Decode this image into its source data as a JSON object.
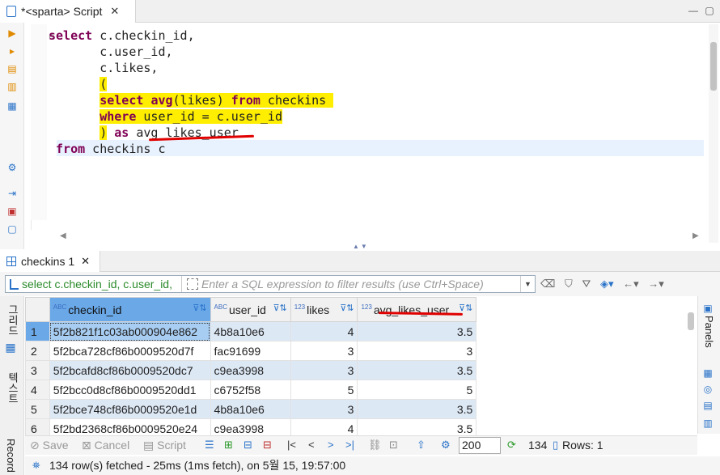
{
  "editor_tab": {
    "title": "*<sparta> Script",
    "close": "✕"
  },
  "window_controls": {
    "minimize": "—",
    "maximize": "▢"
  },
  "code_lines": [
    {
      "parts": [
        {
          "t": "select",
          "k": true
        },
        {
          "t": " c.checkin_id,"
        }
      ]
    },
    {
      "parts": [
        {
          "t": "       c.user_id,"
        }
      ]
    },
    {
      "parts": [
        {
          "t": "       c.likes,"
        }
      ]
    },
    {
      "parts": [
        {
          "t": "       "
        },
        {
          "t": "(",
          "h": true
        }
      ]
    },
    {
      "parts": [
        {
          "t": "       "
        },
        {
          "t": "select",
          "k": true,
          "h": true
        },
        {
          "t": " ",
          "h": true
        },
        {
          "t": "avg",
          "k": true,
          "h": true
        },
        {
          "t": "(likes) ",
          "h": true
        },
        {
          "t": "from",
          "k": true,
          "h": true
        },
        {
          "t": " checkins ",
          "h": true
        }
      ]
    },
    {
      "parts": [
        {
          "t": "       "
        },
        {
          "t": "where",
          "k": true,
          "h": true
        },
        {
          "t": " user_id = c.user_id",
          "h": true
        }
      ]
    },
    {
      "parts": [
        {
          "t": "       "
        },
        {
          "t": ")",
          "h": true
        },
        {
          "t": " "
        },
        {
          "t": "as",
          "k": true
        },
        {
          "t": " avg_likes_user"
        }
      ]
    },
    {
      "parts": [
        {
          "t": " "
        },
        {
          "t": "from",
          "k": true
        },
        {
          "t": " checkins c"
        }
      ]
    }
  ],
  "results_tab": {
    "title": "checkins 1",
    "close": "✕"
  },
  "filter": {
    "query": "select c.checkin_id, c.user_id,",
    "placeholder": "Enter a SQL expression to filter results (use Ctrl+Space)"
  },
  "side_tabs": {
    "grid": "그리드",
    "text": "텍스트",
    "record": "Record"
  },
  "panels_label": "Panels",
  "grid": {
    "columns": [
      {
        "name": "checkin_id",
        "type": "ABC"
      },
      {
        "name": "user_id",
        "type": "ABC"
      },
      {
        "name": "likes",
        "type": "123"
      },
      {
        "name": "avg_likes_user",
        "type": "123"
      }
    ],
    "rows": [
      {
        "n": "1",
        "checkin_id": "5f2b821f1c03ab000904e862",
        "user_id": "4b8a10e6",
        "likes": "4",
        "avg": "3.5"
      },
      {
        "n": "2",
        "checkin_id": "5f2bca728cf86b0009520d7f",
        "user_id": "fac91699",
        "likes": "3",
        "avg": "3"
      },
      {
        "n": "3",
        "checkin_id": "5f2bcafd8cf86b0009520dc7",
        "user_id": "c9ea3998",
        "likes": "3",
        "avg": "3.5"
      },
      {
        "n": "4",
        "checkin_id": "5f2bcc0d8cf86b0009520dd1",
        "user_id": "c6752f58",
        "likes": "5",
        "avg": "5"
      },
      {
        "n": "5",
        "checkin_id": "5f2bce748cf86b0009520e1d",
        "user_id": "4b8a10e6",
        "likes": "3",
        "avg": "3.5"
      },
      {
        "n": "6",
        "checkin_id": "5f2bd2368cf86b0009520e24",
        "user_id": "c9ea3998",
        "likes": "4",
        "avg": "3.5"
      }
    ]
  },
  "bottom": {
    "save": "Save",
    "cancel": "Cancel",
    "script": "Script",
    "fetch_size": "200",
    "total": "134",
    "rows": "Rows: 1"
  },
  "status": "134 row(s) fetched - 25ms (1ms fetch), on 5월 15, 19:57:00",
  "colors": {
    "keyword": "#7f0055",
    "highlight": "#ffee00",
    "selection": "#6aa8e8",
    "accent": "#2a73c9",
    "annotation": "#e00000"
  }
}
